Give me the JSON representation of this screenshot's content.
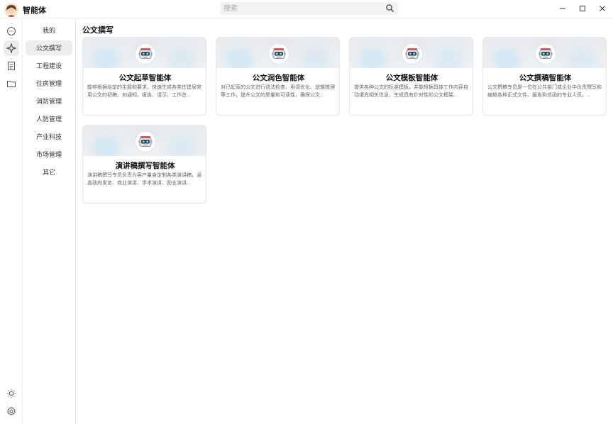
{
  "app": {
    "title": "智能体",
    "search_placeholder": "搜索"
  },
  "rail": {
    "top_icons": [
      "chat-icon",
      "sparkle-icon",
      "document-icon",
      "folder-icon"
    ],
    "bottom_icons": [
      "theme-sun-icon",
      "settings-gear-icon"
    ]
  },
  "categories": {
    "items": [
      "我的",
      "公文撰写",
      "工程建设",
      "住房管理",
      "消防管理",
      "人防管理",
      "产业科技",
      "市场管理",
      "其它"
    ],
    "selected": "公文撰写"
  },
  "main": {
    "section_title": "公文撰写",
    "cards": [
      {
        "title": "公文起草智能体",
        "desc": "能够根据给定的主题和要求，快速生成各类住建局常用公文的初稿，如通知、报告、请示、工作总..."
      },
      {
        "title": "公文润色智能体",
        "desc": "对已起草的公文进行语法检查、用词优化、逻辑梳理等工作，提升公文的质量和可读性，确保公文..."
      },
      {
        "title": "公文模板智能体",
        "desc": "提供各种公文的标准模板，并能根据具体工作内容自动填充相关信息，生成具有针对性的公文框架..."
      },
      {
        "title": "公文撰稿智能体",
        "desc": "公文撰稿专员是一位在公共部门或企业中负责撰写和编辑各种正式文件、报告和信函的专业人员。..."
      },
      {
        "title": "演讲稿撰写智能体",
        "desc": "演讲稿撰写专员负责为客户量身定制各类演讲稿，涵盖政府发言、商业演讲、学术演讲、励志演讲..."
      }
    ]
  },
  "colors": {
    "active_bg": "#ededed",
    "card_border": "#e8e8e8",
    "banner_blue": "#d3e7f3",
    "robot_red": "#d9534f"
  }
}
